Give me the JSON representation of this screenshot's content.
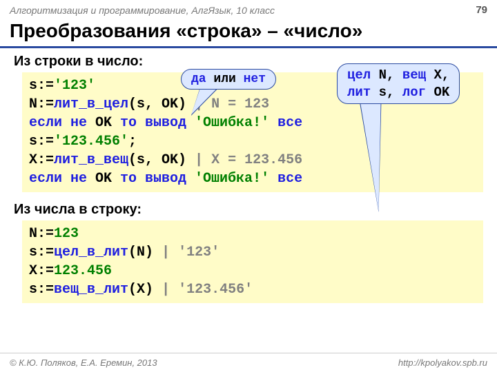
{
  "header": {
    "course": "Алгоритмизация и программирование, АлгЯзык, 10 класс",
    "page": "79"
  },
  "title": "Преобразования «строка» – «число»",
  "section1": {
    "label": "Из строки в число:",
    "callout_yesno_yes": "да",
    "callout_yesno_or": " или ",
    "callout_yesno_no": "нет",
    "decl_int": "цел",
    "decl_N": " N, ",
    "decl_real": "вещ",
    "decl_X": " X,",
    "decl_str": "лит",
    "decl_s": " s, ",
    "decl_bool": "лог",
    "decl_OK": " OK",
    "l1_a": "s:=",
    "l1_b": "'123'",
    "l2_a": "N:=",
    "l2_b": "лит_в_цел",
    "l2_c": "(s, OK) ",
    "l2_d": "| N = 123",
    "l3_a": "если не",
    "l3_b": " OK ",
    "l3_c": "то вывод",
    "l3_d": " 'Ошибка!' ",
    "l3_e": "все",
    "l4_a": "s:=",
    "l4_b": "'123.456'",
    "l4_c": ";",
    "l5_a": "X:=",
    "l5_b": "лит_в_вещ",
    "l5_c": "(s, OK) ",
    "l5_d": "| X = 123.456",
    "l6_a": "если не",
    "l6_b": " OK ",
    "l6_c": "то вывод",
    "l6_d": " 'Ошибка!' ",
    "l6_e": "все"
  },
  "section2": {
    "label": "Из числа в строку:",
    "l1_a": "N:=",
    "l1_b": "123",
    "l2_a": "s:=",
    "l2_b": "цел_в_лит",
    "l2_c": "(N) ",
    "l2_d": "| '123'",
    "l3_a": "X:=",
    "l3_b": "123.456",
    "l4_a": "s:=",
    "l4_b": "вещ_в_лит",
    "l4_c": "(X) ",
    "l4_d": "| '123.456'"
  },
  "footer": {
    "copyright": "© К.Ю. Поляков, Е.А. Еремин, 2013",
    "url": "http://kpolyakov.spb.ru"
  }
}
